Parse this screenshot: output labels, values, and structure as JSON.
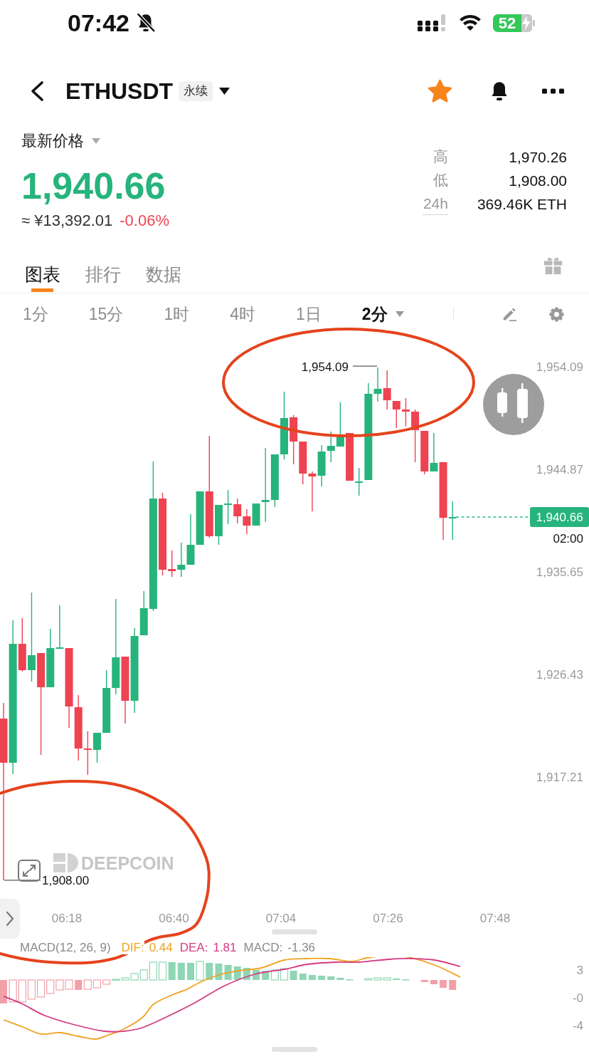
{
  "status_bar": {
    "time": "07:42",
    "silent": true,
    "battery": "52",
    "charging": true
  },
  "header": {
    "symbol": "ETHUSDT",
    "badge": "永续",
    "favorite": true
  },
  "price": {
    "label": "最新价格",
    "last": "1,940.66",
    "last_rising": true,
    "fiat": "≈ ¥13,392.01",
    "change": "-0.06%",
    "change_rising": false
  },
  "stats": [
    {
      "label": "高",
      "value": "1,970.26",
      "underlined": false
    },
    {
      "label": "低",
      "value": "1,908.00",
      "underlined": false
    },
    {
      "label": "24h",
      "value": "369.46K ETH",
      "underlined": true
    }
  ],
  "tabs": [
    {
      "label": "图表",
      "selected": true
    },
    {
      "label": "排行",
      "selected": false
    },
    {
      "label": "数据",
      "selected": false
    }
  ],
  "intervals": [
    {
      "label": "1分",
      "kind": "option",
      "selected": false
    },
    {
      "label": "15分",
      "kind": "option",
      "selected": false
    },
    {
      "label": "1时",
      "kind": "option",
      "selected": false
    },
    {
      "label": "4时",
      "kind": "option",
      "selected": false
    },
    {
      "label": "1日",
      "kind": "option",
      "selected": false
    },
    {
      "label": "2分",
      "kind": "dropdown",
      "selected": true
    }
  ],
  "chart": {
    "y_axis": [
      "1,954.09",
      "1,944.87",
      "1,935.65",
      "1,926.43",
      "1,917.21"
    ],
    "x_axis": [
      "06:18",
      "06:40",
      "07:04",
      "07:26",
      "07:48"
    ],
    "high_label": "1,954.09",
    "low_label": "1,908.00",
    "last_price": "1,940.66",
    "countdown": "02:00",
    "watermark": "DEEPCOIN"
  },
  "indicator": {
    "title": "MACD(12, 26, 9)",
    "values": [
      {
        "label": "DIF:",
        "value": "0.44",
        "color": "#f0a21e"
      },
      {
        "label": "DEA:",
        "value": "1.81",
        "color": "#d43a82"
      },
      {
        "label": "MACD:",
        "value": "-1.36",
        "color": "#8a8a8a"
      }
    ],
    "y_axis": [
      "3",
      "-0",
      "-4"
    ]
  }
}
